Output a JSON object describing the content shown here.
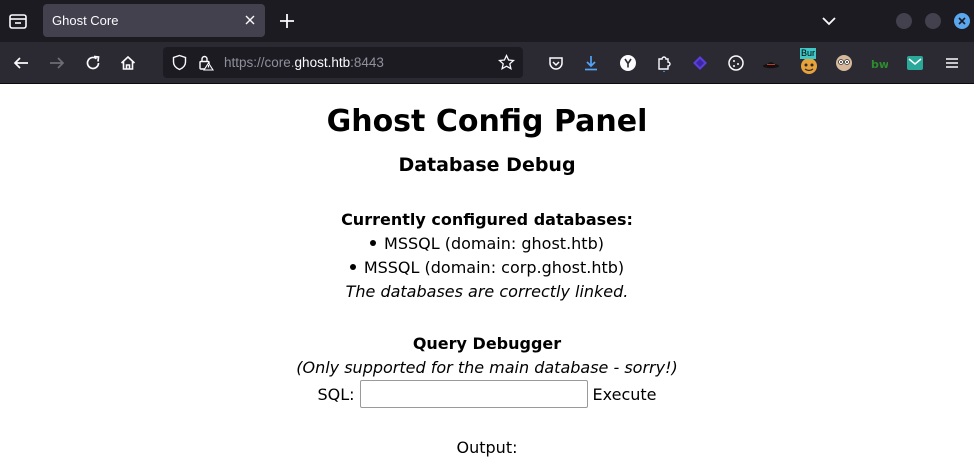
{
  "browser": {
    "tab_title": "Ghost Core",
    "url_prefix": "https://core.",
    "url_host": "ghost.htb",
    "url_suffix": ":8443",
    "extension_badge": "Bur"
  },
  "page": {
    "title": "Ghost Config Panel",
    "subtitle": "Database Debug",
    "databases_heading": "Currently configured databases:",
    "databases": [
      "MSSQL (domain: ghost.htb)",
      "MSSQL (domain: corp.ghost.htb)"
    ],
    "link_status": "The databases are correctly linked.",
    "query_heading": "Query Debugger",
    "query_note": "(Only supported for the main database - sorry!)",
    "sql_label": "SQL:",
    "sql_value": "",
    "execute_label": "Execute",
    "output_label": "Output:"
  }
}
